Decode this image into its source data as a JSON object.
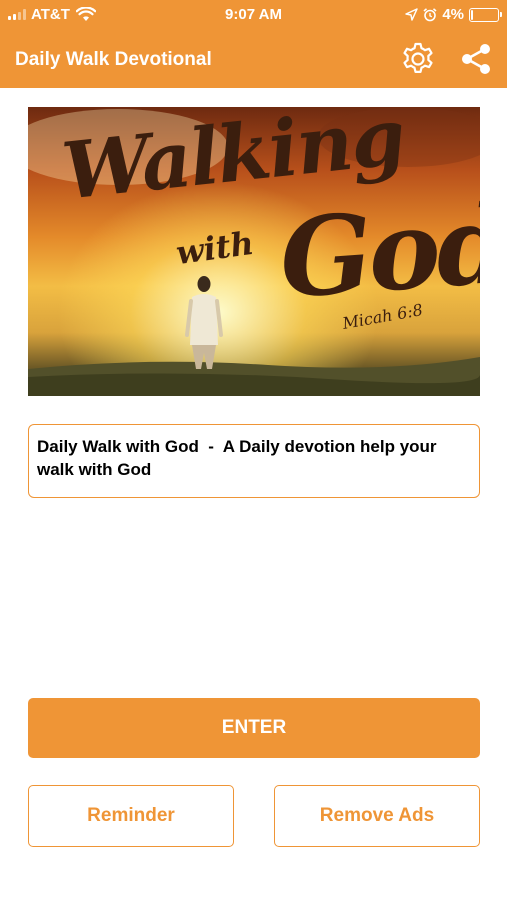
{
  "status_bar": {
    "carrier": "AT&T",
    "time": "9:07 AM",
    "battery": "4%",
    "battery_level": 0.04,
    "icons": [
      "signal-icon",
      "wifi-icon",
      "location-arrow-icon",
      "alarm-icon",
      "battery-icon"
    ]
  },
  "app_bar": {
    "title": "Daily Walk Devotional",
    "icons": [
      "gear-icon",
      "share-icon"
    ]
  },
  "hero": {
    "title_word1": "Walking",
    "title_word2": "with",
    "title_word3": "God",
    "reference": "Micah 6:8"
  },
  "description": {
    "text": "Daily Walk with God  -  A Daily devotion help your walk with God"
  },
  "buttons": {
    "enter": "ENTER",
    "reminder": "Reminder",
    "remove_ads": "Remove Ads"
  },
  "colors": {
    "accent": "#ef9536",
    "text": "#000000",
    "background": "#ffffff"
  }
}
